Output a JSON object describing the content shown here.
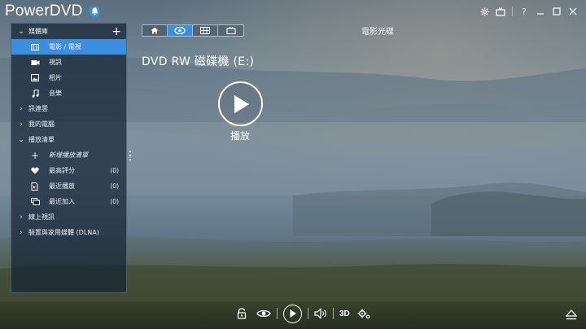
{
  "app": {
    "title": "PowerDVD"
  },
  "window_controls": [
    "settings",
    "tv-mode",
    "help",
    "minimize",
    "maximize",
    "close"
  ],
  "sidebar": {
    "items": [
      {
        "label": "媒體庫",
        "type": "group",
        "expanded": true,
        "icon": "chevron-down-icon"
      },
      {
        "label": "電影 / 電視",
        "type": "sub",
        "active": true,
        "icon": "film-icon"
      },
      {
        "label": "視訊",
        "type": "sub",
        "icon": "video-camera-icon"
      },
      {
        "label": "相片",
        "type": "sub",
        "icon": "photo-icon"
      },
      {
        "label": "音樂",
        "type": "sub",
        "icon": "music-note-icon"
      },
      {
        "label": "訊連雲",
        "type": "group",
        "expanded": false,
        "icon": "chevron-right-icon"
      },
      {
        "label": "我的電腦",
        "type": "group",
        "expanded": false,
        "icon": "chevron-right-icon"
      },
      {
        "label": "播放清單",
        "type": "group",
        "expanded": true,
        "icon": "chevron-down-icon"
      },
      {
        "label": "新增播放清單",
        "type": "sub",
        "italic": true,
        "icon": "plus-icon"
      },
      {
        "label": "最高評分",
        "type": "sub",
        "count": "(0)",
        "icon": "heart-icon"
      },
      {
        "label": "最近播放",
        "type": "sub",
        "count": "(0)",
        "icon": "recent-play-icon"
      },
      {
        "label": "最近加入",
        "type": "sub",
        "count": "(0)",
        "icon": "recently-added-icon"
      },
      {
        "label": "線上視訊",
        "type": "group",
        "expanded": false,
        "icon": "chevron-right-icon"
      },
      {
        "label": "裝置與家用媒體 (DLNA)",
        "type": "group",
        "expanded": false,
        "icon": "chevron-right-icon"
      }
    ]
  },
  "view_tabs": [
    {
      "icon": "home-icon",
      "active": false
    },
    {
      "icon": "disc-icon",
      "active": true
    },
    {
      "icon": "grid-view-icon",
      "active": false
    },
    {
      "icon": "tv-icon",
      "active": false
    }
  ],
  "main": {
    "section_title": "電影光碟",
    "drive_title": "DVD  RW 磁碟機 (E:)",
    "play_label": "播放"
  },
  "player_controls": {
    "buttons": [
      "lock-icon",
      "eye-icon",
      "play-icon",
      "volume-icon",
      "3d",
      "settings-gear-icon"
    ],
    "label_3d": "3D"
  },
  "colors": {
    "accent": "#3a8fe0",
    "sidebar_bg": "#162434",
    "text": "#eef2f6"
  }
}
